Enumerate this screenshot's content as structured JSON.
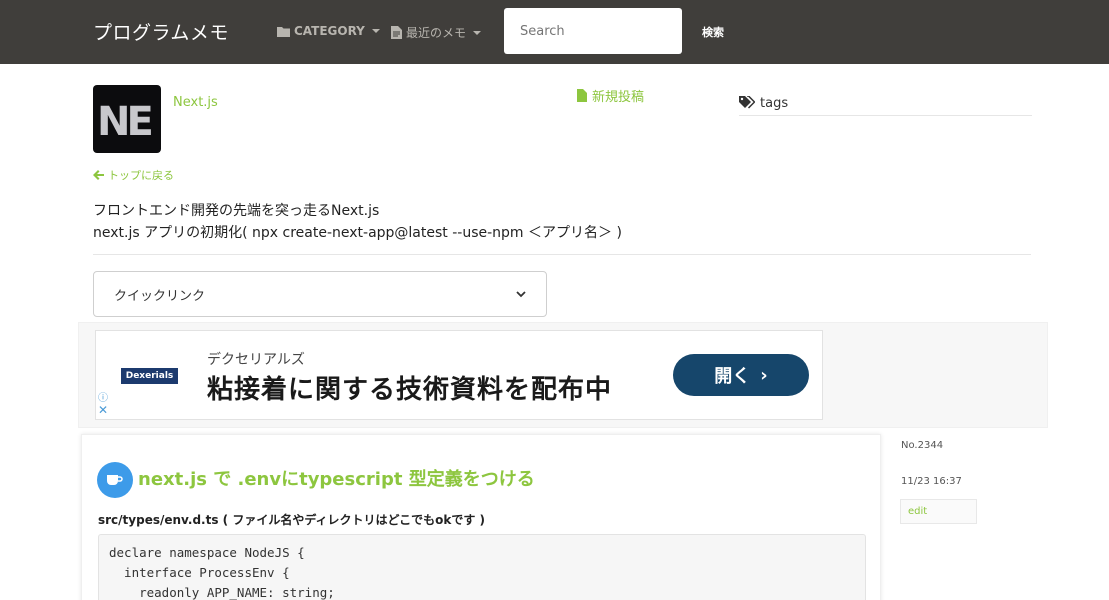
{
  "navbar": {
    "brand": "プログラムメモ",
    "category_label": "CATEGORY",
    "memo_label": "最近のメモ",
    "search_placeholder": "Search",
    "search_button": "検索"
  },
  "header": {
    "logo_text": "NE",
    "category_title": "Next.js",
    "new_post_label": "新規投稿",
    "tags_label": "tags",
    "back_label": "トップに戻る",
    "description_lines": [
      "フロントエンド開発の先端を突っ走るNext.js",
      "next.js アプリの初期化( npx create-next-app@latest --use-npm ＜アプリ名＞ )"
    ]
  },
  "quicklink": {
    "selected": "クイックリンク"
  },
  "ad": {
    "brand": "Dexerials",
    "subtitle": "デクセリアルズ",
    "headline": "粘接着に関する技術資料を配布中",
    "button_label": "開く",
    "button_arrow": "›",
    "info_icon": "ⓘ",
    "close_icon": "✕"
  },
  "article": {
    "title": "next.js で .envにtypescript 型定義をつける",
    "file_path": "src/types/env.d.ts ( ファイル名やディレクトリはどこでもokです )",
    "code": "declare namespace NodeJS {\n  interface ProcessEnv {\n    readonly APP_NAME: string;"
  },
  "meta": {
    "number": "No.2344",
    "date": "11/23 16:37",
    "edit_label": "edit"
  },
  "colors": {
    "accent": "#8dc63f",
    "navbar": "#403e3b",
    "ad_button": "#16466b"
  }
}
